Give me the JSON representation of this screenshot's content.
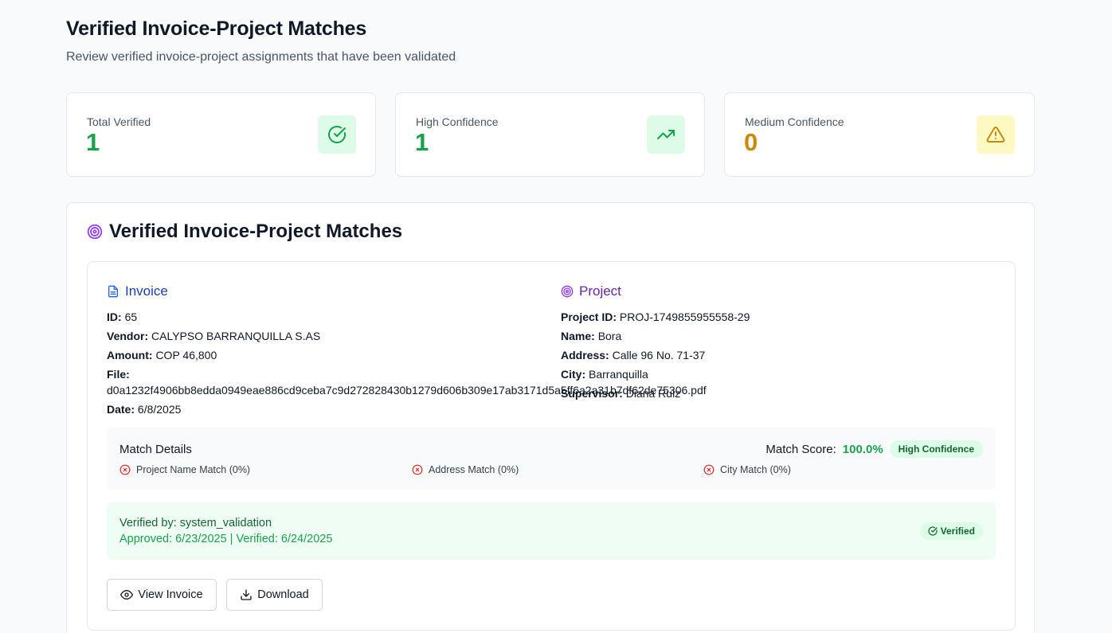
{
  "header": {
    "title": "Verified Invoice-Project Matches",
    "subtitle": "Review verified invoice-project assignments that have been validated"
  },
  "stats": [
    {
      "label": "Total Verified",
      "value": "1",
      "color": "#16a34a",
      "icon": "check-circle-icon"
    },
    {
      "label": "High Confidence",
      "value": "1",
      "color": "#16a34a",
      "icon": "trending-up-icon"
    },
    {
      "label": "Medium Confidence",
      "value": "0",
      "color": "#ca8a04",
      "icon": "warning-triangle-icon"
    }
  ],
  "main": {
    "title": "Verified Invoice-Project Matches",
    "match": {
      "invoice": {
        "heading": "Invoice",
        "id_label": "ID:",
        "id": "65",
        "vendor_label": "Vendor:",
        "vendor": "CALYPSO BARRANQUILLA S.AS",
        "amount_label": "Amount:",
        "amount": "COP 46,800",
        "file_label": "File:",
        "file": "d0a1232f4906bb8edda0949eae886cd9ceba7c9d272828430b1279d606b309e17ab3171d5a5ff6a2a31b7df62de75306.pdf",
        "date_label": "Date:",
        "date": "6/8/2025"
      },
      "project": {
        "heading": "Project",
        "project_id_label": "Project ID:",
        "project_id": "PROJ-1749855955558-29",
        "name_label": "Name:",
        "name": "Bora",
        "address_label": "Address:",
        "address": "Calle 96 No. 71-37",
        "city_label": "City:",
        "city": "Barranquilla",
        "supervisor_label": "Supervisor:",
        "supervisor": "Diana Ruiz"
      },
      "details": {
        "title": "Match Details",
        "score_label": "Match Score:",
        "score": "100.0%",
        "confidence_badge": "High Confidence",
        "criteria": [
          {
            "label": "Project Name Match (0%)",
            "status": "fail"
          },
          {
            "label": "Address Match (0%)",
            "status": "fail"
          },
          {
            "label": "City Match (0%)",
            "status": "fail"
          }
        ]
      },
      "verification": {
        "verified_by": "Verified by: system_validation",
        "dates": "Approved: 6/23/2025 | Verified: 6/24/2025",
        "badge": "Verified"
      },
      "actions": {
        "view_label": "View Invoice",
        "download_label": "Download"
      }
    }
  }
}
